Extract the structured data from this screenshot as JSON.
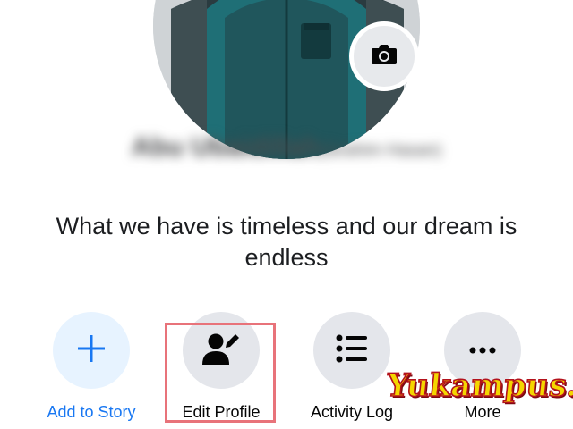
{
  "profile": {
    "name": "Abu Ubaidillah",
    "name_suffix": "(Ibrahim Hasan)",
    "bio": "What we have is timeless and our dream is endless"
  },
  "actions": [
    {
      "label": "Add to Story",
      "icon": "plus-icon",
      "color": "#1877f2",
      "circle_bg": "#e7f3ff"
    },
    {
      "label": "Edit Profile",
      "icon": "edit-profile-icon",
      "color": "#050505",
      "circle_bg": "#e4e6eb",
      "highlighted": true
    },
    {
      "label": "Activity Log",
      "icon": "list-icon",
      "color": "#050505",
      "circle_bg": "#e4e6eb"
    },
    {
      "label": "More",
      "icon": "more-dots-icon",
      "color": "#050505",
      "circle_bg": "#e4e6eb"
    }
  ],
  "camera_button": {
    "icon": "camera-icon"
  },
  "watermark": {
    "text": "Yukampus.com",
    "fill": "#f4d600",
    "stroke": "#b3121c"
  },
  "colors": {
    "accent": "#1877f2",
    "highlight_box": "#e8737a"
  }
}
